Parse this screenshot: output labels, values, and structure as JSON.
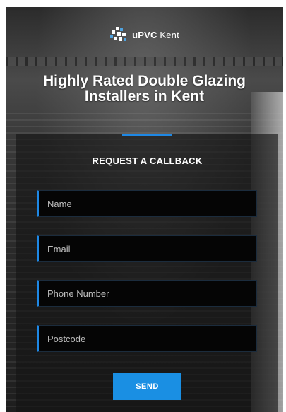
{
  "header": {
    "logo_icon": "upvc-kent-logo-icon",
    "brand_bold": "uPVC",
    "brand_light": " Kent"
  },
  "hero": {
    "headline": "Highly Rated Double Glazing Installers in Kent"
  },
  "form": {
    "title": "REQUEST A CALLBACK",
    "accent_color": "#1e88e5",
    "fields": [
      {
        "placeholder": "Name",
        "value": ""
      },
      {
        "placeholder": "Email",
        "value": ""
      },
      {
        "placeholder": "Phone Number",
        "value": ""
      },
      {
        "placeholder": "Postcode",
        "value": ""
      }
    ],
    "submit_label": "SEND",
    "submit_color": "#1a8fe3"
  }
}
